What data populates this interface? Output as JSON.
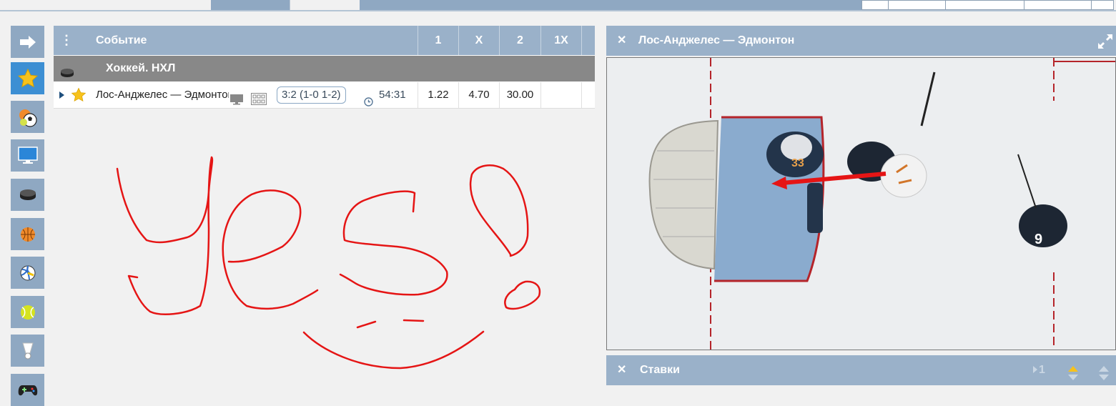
{
  "sidebar": {
    "items": [
      {
        "name": "collapse-arrow-icon",
        "active": false
      },
      {
        "name": "favorites-star-icon",
        "active": true
      },
      {
        "name": "multi-sport-icon",
        "active": false
      },
      {
        "name": "tv-icon",
        "active": false
      },
      {
        "name": "hockey-puck-icon",
        "active": false
      },
      {
        "name": "basketball-icon",
        "active": false
      },
      {
        "name": "volleyball-icon",
        "active": false
      },
      {
        "name": "tennis-ball-icon",
        "active": false
      },
      {
        "name": "badminton-icon",
        "active": false
      },
      {
        "name": "gamepad-icon",
        "active": false
      }
    ]
  },
  "table": {
    "menu_icon": "⋮",
    "header": {
      "event": "Событие",
      "col1": "1",
      "colx": "X",
      "col2": "2",
      "col1x": "1X"
    },
    "sport": {
      "label": "Хоккей. НХЛ"
    },
    "event": {
      "teams": "Лос-Анджелес — Эдмонтон",
      "score": "3:2 (1-0 1-2)",
      "time": "54:31",
      "odd1": "1.22",
      "oddx": "4.70",
      "odd2": "30.00",
      "odd1x": ""
    }
  },
  "video_panel": {
    "close": "✕",
    "title": "Лос-Анджелес — Эдмонтон"
  },
  "bets_panel": {
    "close": "✕",
    "title": "Ставки",
    "count": "1"
  },
  "colors": {
    "header_bg": "#9ab1c9",
    "sidebar_bg": "#8fa8c2",
    "sidebar_active": "#3d8fd3",
    "sport_row_bg": "#888888",
    "doodle": "#e51515"
  }
}
